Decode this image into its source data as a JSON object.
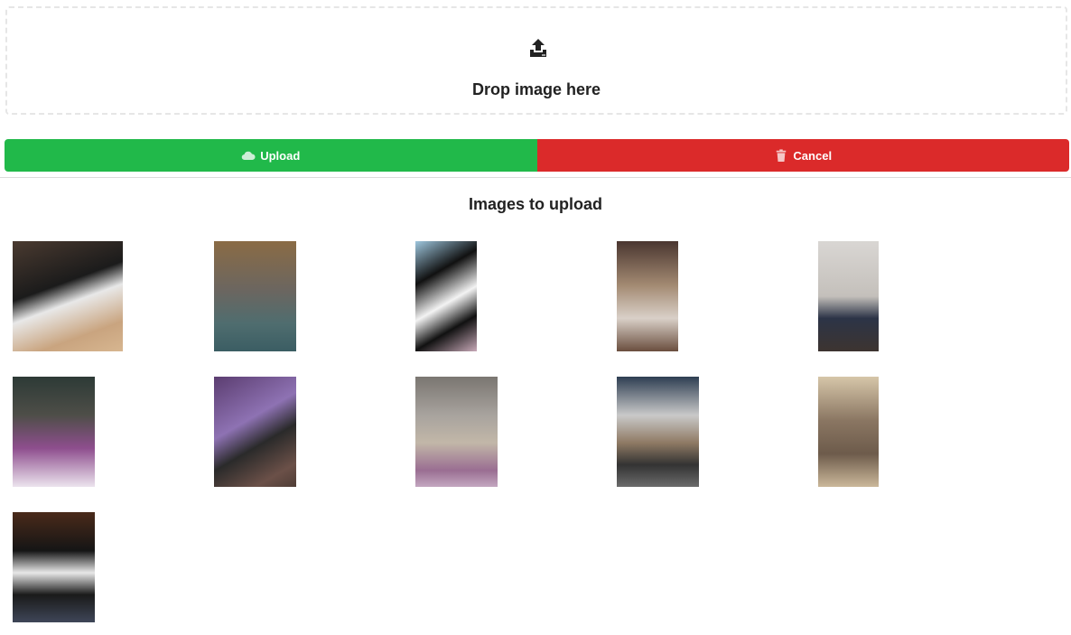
{
  "dropzone": {
    "label": "Drop image here",
    "icon": "upload-tray-icon"
  },
  "buttons": {
    "upload_label": "Upload",
    "upload_icon": "cloud-icon",
    "upload_color": "#21b94a",
    "cancel_label": "Cancel",
    "cancel_icon": "trash-icon",
    "cancel_color": "#db2a2a"
  },
  "section": {
    "title": "Images to upload"
  },
  "images": [
    {
      "subject": "cat-photo"
    },
    {
      "subject": "cat-photo"
    },
    {
      "subject": "cat-photo"
    },
    {
      "subject": "cat-photo"
    },
    {
      "subject": "cat-photo"
    },
    {
      "subject": "cat-photo"
    },
    {
      "subject": "cat-photo"
    },
    {
      "subject": "cat-photo"
    },
    {
      "subject": "cat-photo"
    },
    {
      "subject": "cat-photo"
    },
    {
      "subject": "cat-photo"
    }
  ]
}
